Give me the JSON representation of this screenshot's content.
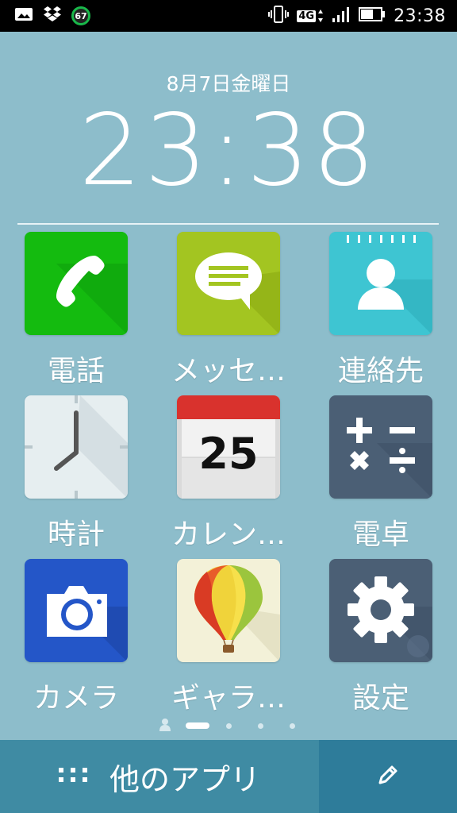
{
  "status_bar": {
    "notification_icons": [
      "image-icon",
      "dropbox-icon",
      "battery-saver-badge-icon"
    ],
    "badge_value": "67",
    "network_label": "4G",
    "time": "23:38"
  },
  "clock_widget": {
    "date": "8月7日金曜日",
    "time": "23:38"
  },
  "apps": [
    {
      "label": "電話",
      "icon": "phone-icon",
      "color": "#14bb0f"
    },
    {
      "label": "メッセ…",
      "icon": "message-icon",
      "color": "#a3c521"
    },
    {
      "label": "連絡先",
      "icon": "contacts-icon",
      "color": "#3ec5d2"
    },
    {
      "label": "時計",
      "icon": "clock-icon",
      "color": "#e6eef0"
    },
    {
      "label": "カレン…",
      "icon": "calendar-icon",
      "color": "#ececec",
      "day": "25"
    },
    {
      "label": "電卓",
      "icon": "calculator-icon",
      "color": "#4b5f75"
    },
    {
      "label": "カメラ",
      "icon": "camera-icon",
      "color": "#2456c8"
    },
    {
      "label": "ギャラ…",
      "icon": "gallery-icon",
      "color": "#f3f1d8"
    },
    {
      "label": "設定",
      "icon": "settings-icon",
      "color": "#4b5f75"
    }
  ],
  "pager": {
    "pages": 5,
    "current": 1
  },
  "bottom_bar": {
    "more_apps_label": "他のアプリ",
    "edit_icon": "pencil-icon"
  }
}
